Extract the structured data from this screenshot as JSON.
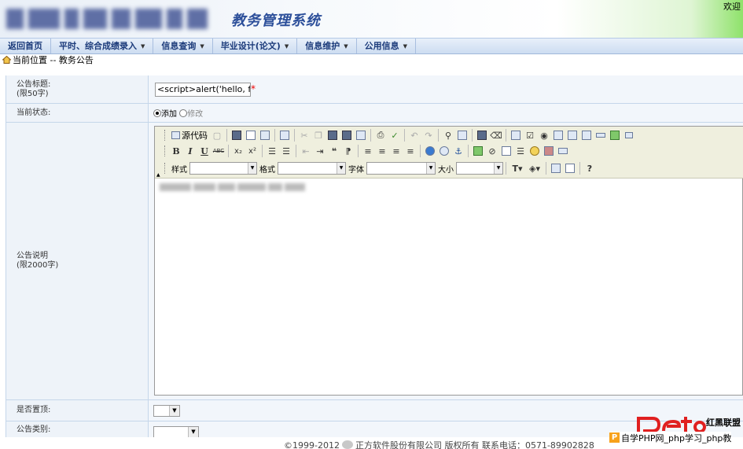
{
  "header": {
    "system_title": "教务管理系统",
    "welcome": "欢迎"
  },
  "nav": {
    "items": [
      {
        "label": "返回首页",
        "has_dropdown": false
      },
      {
        "label": "平时、综合成绩录入",
        "has_dropdown": true
      },
      {
        "label": "信息查询",
        "has_dropdown": true
      },
      {
        "label": "毕业设计(论文)",
        "has_dropdown": true
      },
      {
        "label": "信息维护",
        "has_dropdown": true
      },
      {
        "label": "公用信息",
        "has_dropdown": true
      }
    ]
  },
  "location": {
    "text": "当前位置 -- 教务公告"
  },
  "form": {
    "title_label": "公告标题:",
    "title_limit": "(限50字)",
    "title_value": "<script>alert('hello, fri",
    "required_mark": "*",
    "status_label": "当前状态:",
    "status_options": [
      "添加",
      "修改"
    ],
    "status_selected": "添加",
    "desc_label": "公告说明",
    "desc_limit": "(限2000字)",
    "top_label": "是否置顶:",
    "category_label": "公告类别:"
  },
  "editor": {
    "source_label": "源代码",
    "style_label": "样式",
    "format_label": "格式",
    "font_label": "字体",
    "size_label": "大小",
    "bold": "B",
    "italic": "I",
    "underline": "U",
    "strike": "ABC",
    "subscript": "x₂",
    "superscript": "x²"
  },
  "footer": {
    "copyright": "©1999-2012",
    "company": "正方软件股份有限公司 版权所有  联系电话：0571-89902828"
  },
  "watermark": {
    "brand": "红黑联盟",
    "line": "自学PHP网_php学习_php教"
  },
  "colors": {
    "nav_text": "#1b3a7a",
    "title_text": "#2c4f9a",
    "label_bg": "#eef3f9",
    "border": "#c5d6ea",
    "toolbar_bg": "#efefde",
    "required": "#ee0000"
  }
}
